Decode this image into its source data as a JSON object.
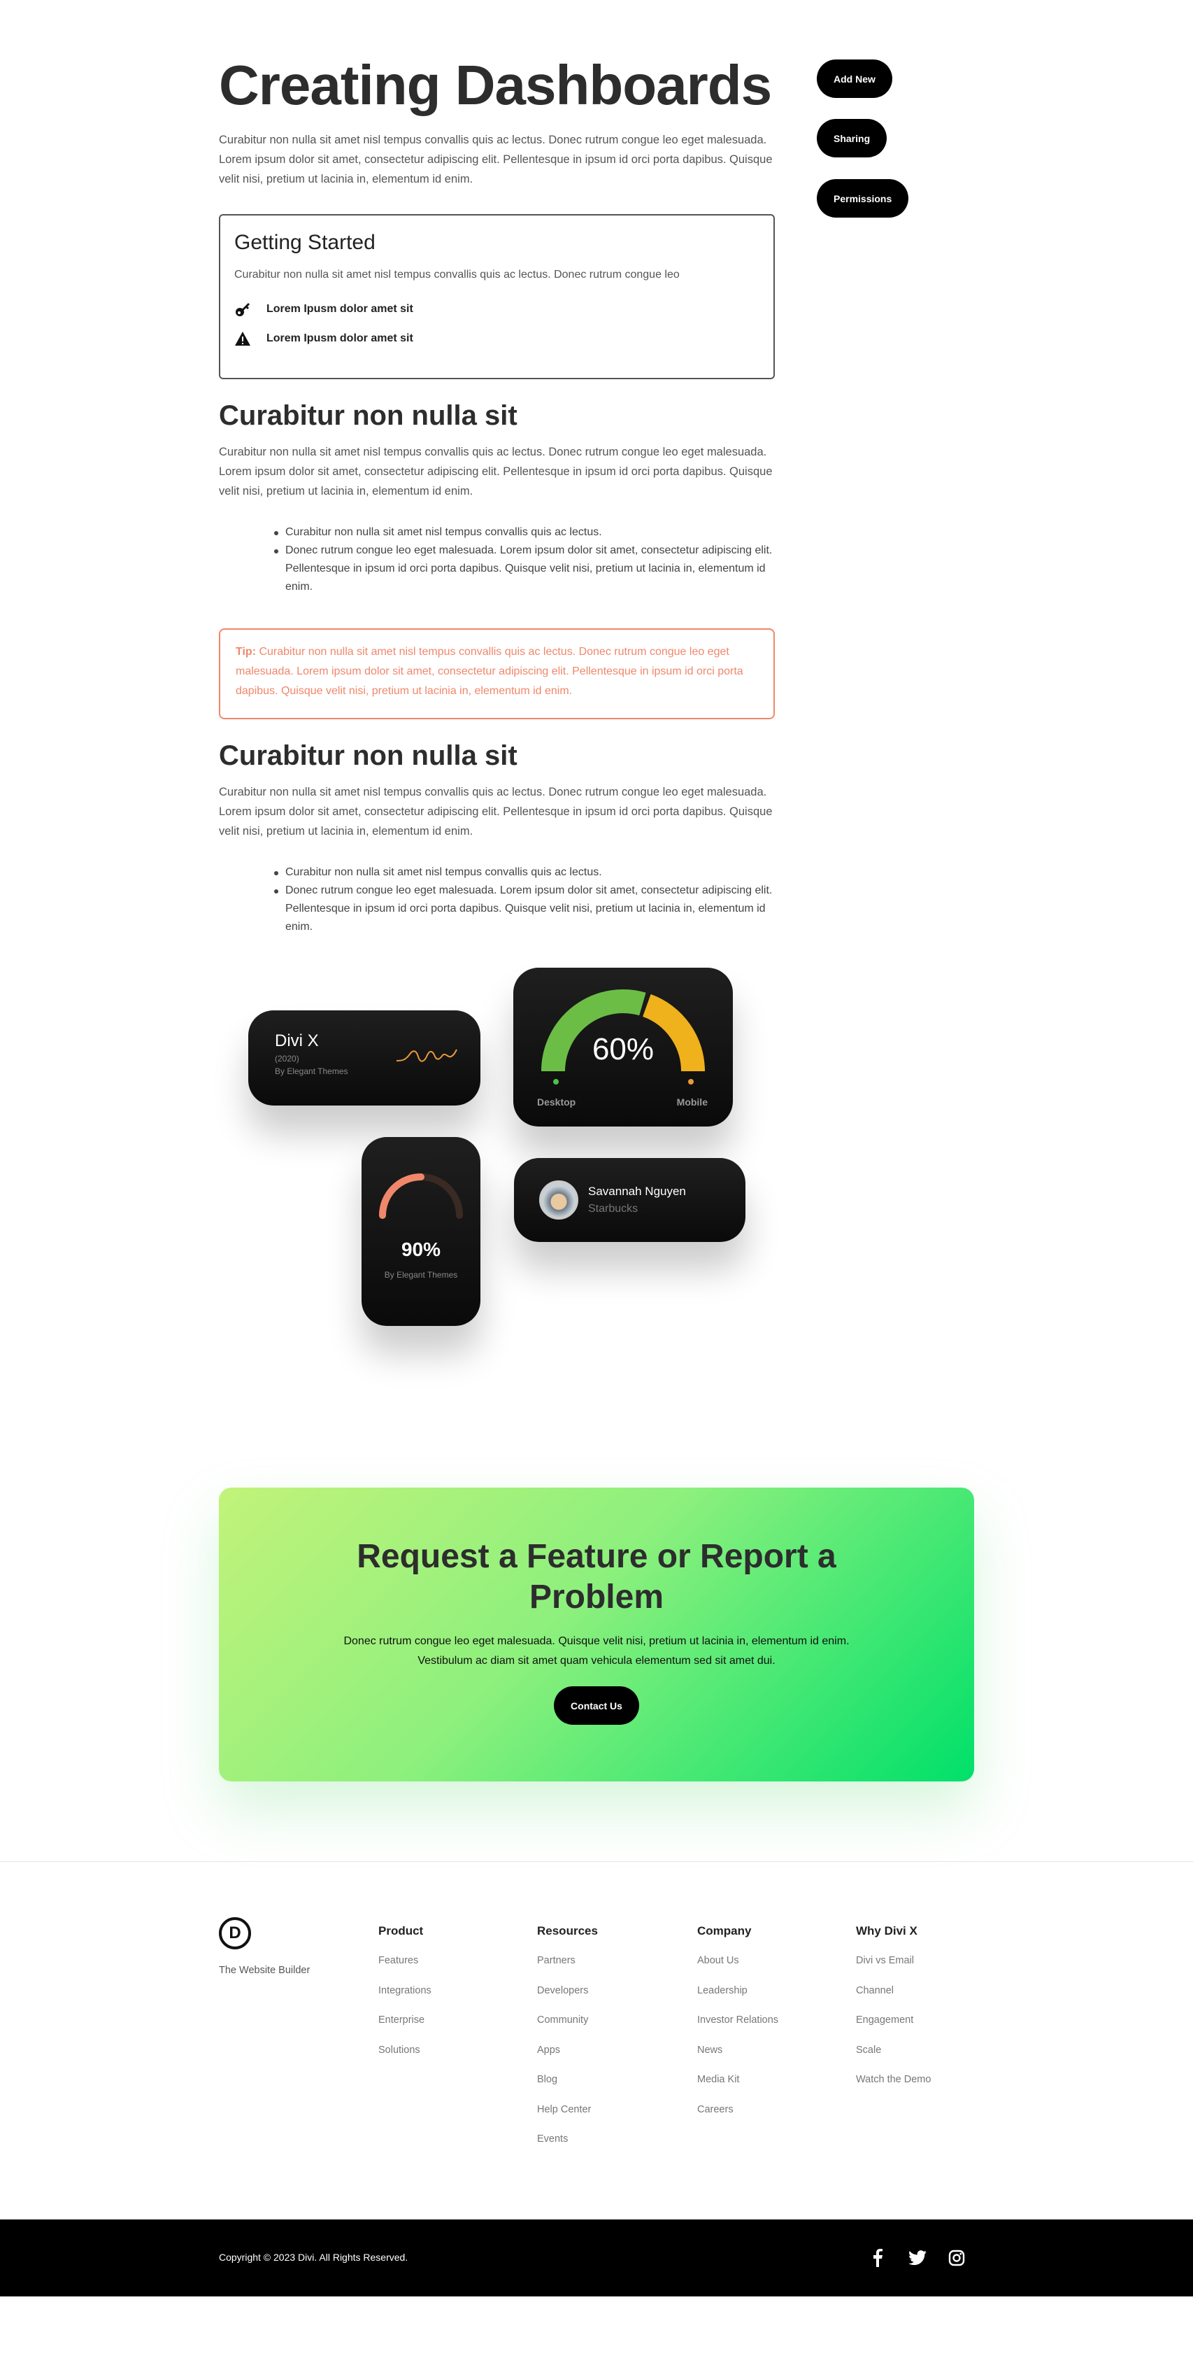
{
  "title": "Creating Dashboards",
  "intro": "Curabitur non nulla sit amet nisl tempus convallis quis ac lectus. Donec rutrum congue leo eget malesuada. Lorem ipsum dolor sit amet, consectetur adipiscing elit. Pellentesque in ipsum id orci porta dapibus. Quisque velit nisi, pretium ut lacinia in, elementum id enim.",
  "sidebar": {
    "buttons": [
      "Add New",
      "Sharing",
      "Permissions"
    ]
  },
  "getting_started": {
    "title": "Getting Started",
    "text": "Curabitur non nulla sit amet nisl tempus convallis quis ac lectus. Donec rutrum congue leo",
    "items": [
      {
        "icon": "key-icon",
        "label": "Lorem Ipusm dolor amet sit"
      },
      {
        "icon": "warning-icon",
        "label": "Lorem Ipusm dolor amet sit"
      }
    ]
  },
  "sections": [
    {
      "heading": "Curabitur non nulla sit",
      "text": "Curabitur non nulla sit amet nisl tempus convallis quis ac lectus. Donec rutrum congue leo eget malesuada. Lorem ipsum dolor sit amet, consectetur adipiscing elit. Pellentesque in ipsum id orci porta dapibus. Quisque velit nisi, pretium ut lacinia in, elementum id enim.",
      "bullets": [
        "Curabitur non nulla sit amet nisl tempus convallis quis ac lectus.",
        "Donec rutrum congue leo eget malesuada. Lorem ipsum dolor sit amet, consectetur adipiscing elit. Pellentesque in ipsum id orci porta dapibus. Quisque velit nisi, pretium ut lacinia in, elementum id enim."
      ]
    },
    {
      "heading": "Curabitur non nulla sit",
      "text": "Curabitur non nulla sit amet nisl tempus convallis quis ac lectus. Donec rutrum congue leo eget malesuada. Lorem ipsum dolor sit amet, consectetur adipiscing elit. Pellentesque in ipsum id orci porta dapibus. Quisque velit nisi, pretium ut lacinia in, elementum id enim.",
      "bullets": [
        "Curabitur non nulla sit amet nisl tempus convallis quis ac lectus.",
        "Donec rutrum congue leo eget malesuada. Lorem ipsum dolor sit amet, consectetur adipiscing elit. Pellentesque in ipsum id orci porta dapibus. Quisque velit nisi, pretium ut lacinia in, elementum id enim."
      ]
    }
  ],
  "tip": {
    "label": "Tip:",
    "text": " Curabitur non nulla sit amet nisl tempus convallis quis ac lectus. Donec rutrum congue leo eget malesuada. Lorem ipsum dolor sit amet, consectetur adipiscing elit. Pellentesque in ipsum id orci porta dapibus. Quisque velit nisi, pretium ut lacinia in, elementum id enim.",
    "color": "#f0876b"
  },
  "widgets": {
    "divi": {
      "title": "Divi X",
      "year": "(2020)",
      "by": "By Elegant Themes"
    },
    "gauge": {
      "value": "60%",
      "fraction": 0.6,
      "left": "Desktop",
      "right": "Mobile",
      "colors": [
        "#6cbd45",
        "#efb21d"
      ]
    },
    "progress": {
      "value": "90%",
      "by": "By Elegant Themes",
      "color": "#f0876b"
    },
    "profile": {
      "name": "Savannah Nguyen",
      "company": "Starbucks"
    }
  },
  "cta": {
    "title": "Request a Feature or Report a Problem",
    "text": "Donec rutrum congue leo eget malesuada. Quisque velit nisi, pretium ut lacinia in, elementum id enim. Vestibulum ac diam sit amet quam vehicula elementum sed sit amet dui.",
    "button": "Contact Us"
  },
  "footer": {
    "logo_letter": "D",
    "tagline": "The Website Builder",
    "columns": [
      {
        "title": "Product",
        "links": [
          "Features",
          "Integrations",
          "Enterprise",
          "Solutions"
        ]
      },
      {
        "title": "Resources",
        "links": [
          "Partners",
          "Developers",
          "Community",
          "Apps",
          "Blog",
          "Help Center",
          "Events"
        ]
      },
      {
        "title": "Company",
        "links": [
          "About Us",
          "Leadership",
          "Investor Relations",
          "News",
          "Media Kit",
          "Careers"
        ]
      },
      {
        "title": "Why Divi X",
        "links": [
          "Divi vs Email",
          "Channel",
          "Engagement",
          "Scale",
          "Watch the Demo"
        ]
      }
    ],
    "copyright": "Copyright © 2023 Divi. All Rights Reserved.",
    "social": [
      "facebook-icon",
      "twitter-icon",
      "instagram-icon"
    ]
  }
}
